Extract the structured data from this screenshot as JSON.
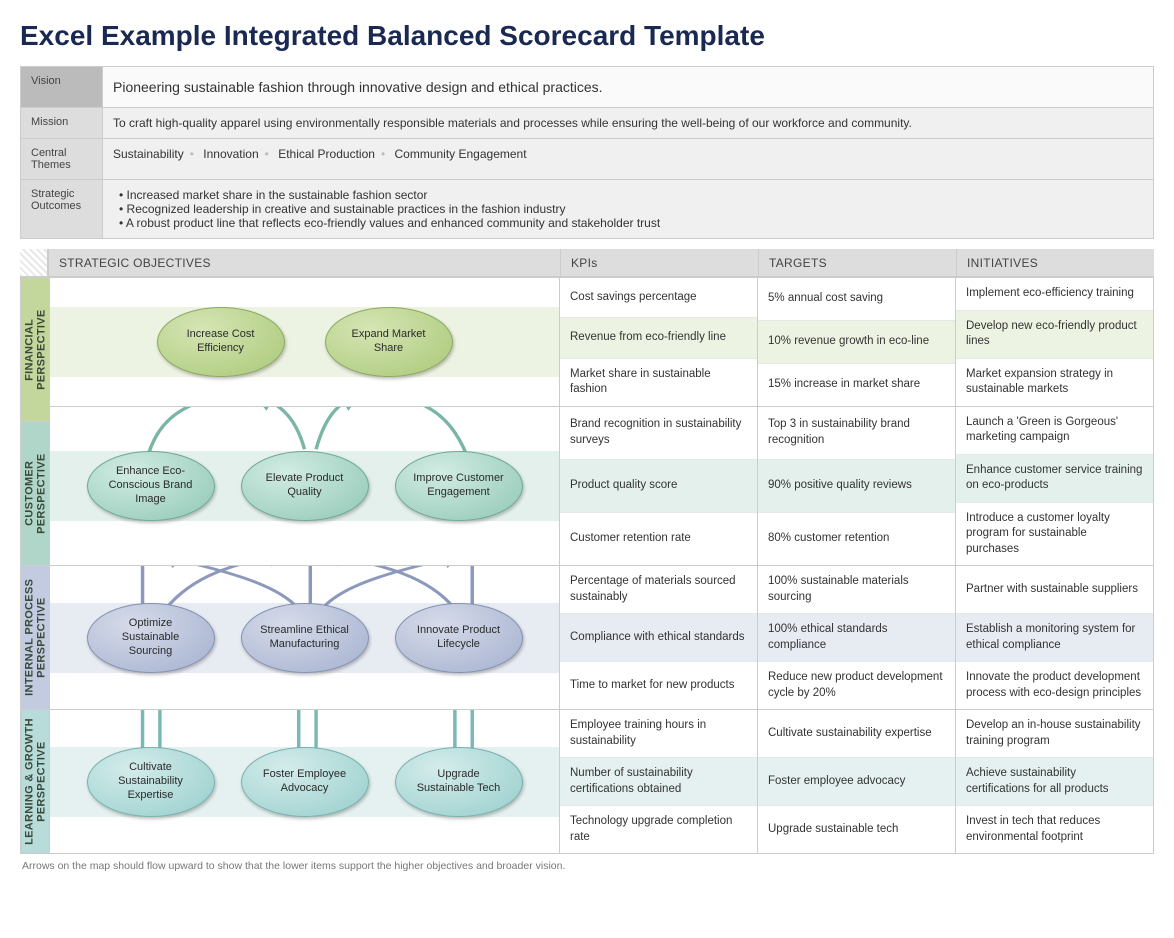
{
  "title": "Excel Example Integrated Balanced Scorecard Template",
  "header": {
    "vision_label": "Vision",
    "vision": "Pioneering sustainable fashion through innovative design and ethical practices.",
    "mission_label": "Mission",
    "mission": "To craft high-quality apparel using environmentally responsible materials and processes while ensuring the well-being of our workforce and community.",
    "themes_label": "Central Themes",
    "themes": [
      "Sustainability",
      "Innovation",
      "Ethical Production",
      "Community Engagement"
    ],
    "outcomes_label": "Strategic Outcomes",
    "outcomes": [
      "Increased market share in the sustainable fashion sector",
      "Recognized leadership in creative and sustainable practices in the fashion industry",
      "A robust product line that reflects eco-friendly values and enhanced community and stakeholder trust"
    ]
  },
  "columns": {
    "strategic_objectives": "STRATEGIC OBJECTIVES",
    "kpis": "KPIs",
    "targets": "TARGETS",
    "initiatives": "INITIATIVES"
  },
  "perspectives": [
    {
      "key": "financial",
      "label": "FINANCIAL PERSPECTIVE",
      "objectives": [
        "Increase Cost Efficiency",
        "Expand Market Share"
      ],
      "rows": [
        {
          "kpi": "Cost savings percentage",
          "target": "5% annual cost saving",
          "initiative": "Implement eco-efficiency training"
        },
        {
          "kpi": "Revenue from eco-friendly line",
          "target": "10% revenue growth in eco-line",
          "initiative": "Develop new eco-friendly product lines"
        },
        {
          "kpi": "Market share in sustainable fashion",
          "target": "15% increase in market share",
          "initiative": "Market expansion strategy in sustainable markets"
        }
      ]
    },
    {
      "key": "customer",
      "label": "CUSTOMER PERSPECTIVE",
      "objectives": [
        "Enhance Eco-Conscious Brand Image",
        "Elevate Product Quality",
        "Improve Customer Engagement"
      ],
      "rows": [
        {
          "kpi": "Brand recognition in sustainability surveys",
          "target": "Top 3 in sustainability brand recognition",
          "initiative": "Launch a 'Green is Gorgeous' marketing campaign"
        },
        {
          "kpi": "Product quality score",
          "target": "90% positive quality reviews",
          "initiative": "Enhance customer service training on eco-products"
        },
        {
          "kpi": "Customer retention rate",
          "target": "80% customer retention",
          "initiative": "Introduce a customer loyalty program for sustainable purchases"
        }
      ]
    },
    {
      "key": "internal",
      "label": "INTERNAL PROCESS PERSPECTIVE",
      "objectives": [
        "Optimize Sustainable Sourcing",
        "Streamline Ethical Manufacturing",
        "Innovate Product Lifecycle"
      ],
      "rows": [
        {
          "kpi": "Percentage of materials sourced sustainably",
          "target": "100% sustainable materials sourcing",
          "initiative": "Partner with sustainable suppliers"
        },
        {
          "kpi": "Compliance with ethical standards",
          "target": "100% ethical standards compliance",
          "initiative": "Establish a monitoring system for ethical compliance"
        },
        {
          "kpi": "Time to market for new products",
          "target": "Reduce new product development cycle by 20%",
          "initiative": "Innovate the product development process with eco-design principles"
        }
      ]
    },
    {
      "key": "learning",
      "label": "LEARNING & GROWTH PERSPECTIVE",
      "objectives": [
        "Cultivate Sustainability Expertise",
        "Foster Employee Advocacy",
        "Upgrade Sustainable Tech"
      ],
      "rows": [
        {
          "kpi": "Employee training hours in sustainability",
          "target": "Cultivate sustainability expertise",
          "initiative": "Develop an in-house sustainability training program"
        },
        {
          "kpi": "Number of sustainability certifications obtained",
          "target": "Foster employee advocacy",
          "initiative": "Achieve sustainability certifications for all products"
        },
        {
          "kpi": "Technology upgrade completion rate",
          "target": "Upgrade sustainable tech",
          "initiative": "Invest in tech that reduces environmental footprint"
        }
      ]
    }
  ],
  "footnote": "Arrows on the map should flow upward to show that the lower items support the higher objectives and broader vision."
}
